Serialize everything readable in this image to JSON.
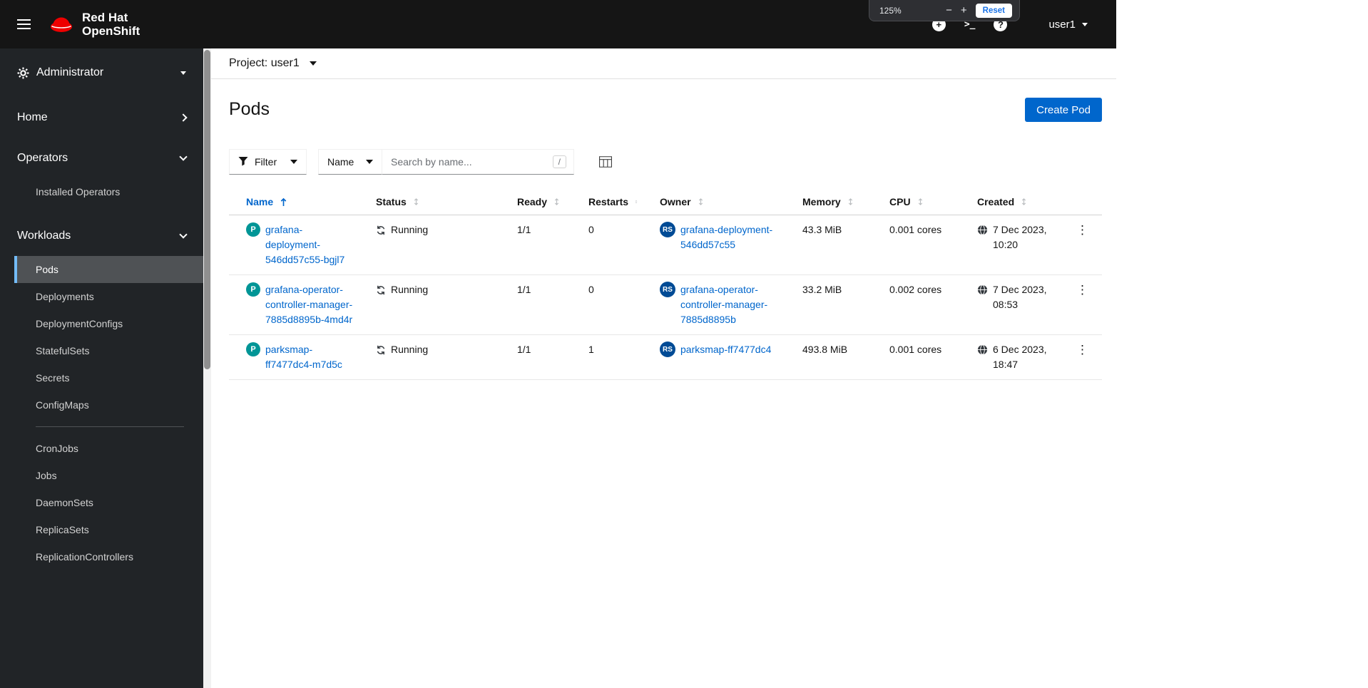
{
  "colors": {
    "accent": "#0066cc",
    "masthead_bg": "#151515",
    "sidebar_bg": "#212427",
    "nav_active_bg": "#4f5255",
    "nav_active_border": "#73bcf7",
    "pod_badge": "#009596",
    "replicaset_badge": "#004b95",
    "brand_red": "#ee0000"
  },
  "masthead": {
    "brand_line1": "Red Hat",
    "brand_line2": "OpenShift",
    "icons": [
      {
        "name": "quick-create-icon",
        "glyph": "+"
      },
      {
        "name": "terminal-icon",
        "glyph": ">_"
      },
      {
        "name": "help-icon",
        "glyph": "?"
      }
    ],
    "user": "user1"
  },
  "zoom_popup": {
    "level": "125%",
    "minus": "−",
    "plus": "+",
    "reset": "Reset"
  },
  "sidebar": {
    "perspective": "Administrator",
    "home_label": "Home",
    "operators_label": "Operators",
    "operators_children": [
      "Installed Operators"
    ],
    "workloads_label": "Workloads",
    "workloads_top": [
      "Pods",
      "Deployments",
      "DeploymentConfigs",
      "StatefulSets",
      "Secrets",
      "ConfigMaps"
    ],
    "workloads_bottom": [
      "CronJobs",
      "Jobs",
      "DaemonSets",
      "ReplicaSets",
      "ReplicationControllers"
    ],
    "active_item": "Pods"
  },
  "project_bar": {
    "selector_label": "Project: user1"
  },
  "page": {
    "title": "Pods",
    "create_button": "Create Pod"
  },
  "toolbar": {
    "filter_label": "Filter",
    "attribute_label": "Name",
    "search_placeholder": "Search by name...",
    "search_value": "",
    "shortcut_key": "/"
  },
  "table": {
    "sorted_by": "Name",
    "sort_direction": "ascending",
    "columns": [
      "Name",
      "Status",
      "Ready",
      "Restarts",
      "Owner",
      "Memory",
      "CPU",
      "Created"
    ],
    "rows": [
      {
        "badge": "P",
        "name": "grafana-deployment-546dd57c55-bgjl7",
        "status": "Running",
        "ready": "1/1",
        "restarts": "0",
        "owner_badge": "RS",
        "owner": "grafana-deployment-546dd57c55",
        "memory": "43.3 MiB",
        "cpu": "0.001 cores",
        "created_date": "7 Dec 2023,",
        "created_time": "10:20"
      },
      {
        "badge": "P",
        "name": "grafana-operator-controller-manager-7885d8895b-4md4r",
        "status": "Running",
        "ready": "1/1",
        "restarts": "0",
        "owner_badge": "RS",
        "owner": "grafana-operator-controller-manager-7885d8895b",
        "memory": "33.2 MiB",
        "cpu": "0.002 cores",
        "created_date": "7 Dec 2023,",
        "created_time": "08:53"
      },
      {
        "badge": "P",
        "name": "parksmap-ff7477dc4-m7d5c",
        "status": "Running",
        "ready": "1/1",
        "restarts": "1",
        "owner_badge": "RS",
        "owner": "parksmap-ff7477dc4",
        "memory": "493.8 MiB",
        "cpu": "0.001 cores",
        "created_date": "6 Dec 2023,",
        "created_time": "18:47"
      }
    ]
  },
  "icons": {
    "kebab": "⋮"
  }
}
